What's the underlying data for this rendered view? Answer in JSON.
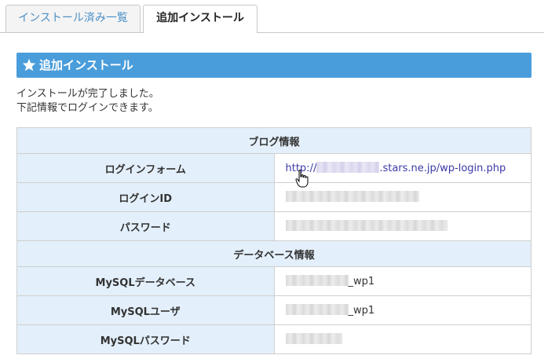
{
  "tabs": [
    {
      "label": "インストール済み一覧",
      "active": false
    },
    {
      "label": "追加インストール",
      "active": true
    }
  ],
  "section": {
    "title": "追加インストール",
    "icon": "star-icon"
  },
  "message": {
    "line1": "インストールが完了しました。",
    "line2": "下記情報でログインできます。"
  },
  "blog_info": {
    "header": "ブログ情報",
    "rows": {
      "login_form": {
        "label": "ログインフォーム",
        "url_prefix": "http://",
        "url_suffix": ".stars.ne.jp/wp-login.php"
      },
      "login_id": {
        "label": "ログインID"
      },
      "password": {
        "label": "パスワード"
      }
    }
  },
  "db_info": {
    "header": "データベース情報",
    "rows": {
      "mysql_db": {
        "label": "MySQLデータベース",
        "suffix": "_wp1"
      },
      "mysql_user": {
        "label": "MySQLユーザ",
        "suffix": "_wp1"
      },
      "mysql_password": {
        "label": "MySQLパスワード"
      }
    }
  },
  "colors": {
    "header_blue": "#4a9ddb",
    "label_bg": "#e3effa",
    "link": "#3a3aa8",
    "tab_text": "#4a8fc6"
  }
}
